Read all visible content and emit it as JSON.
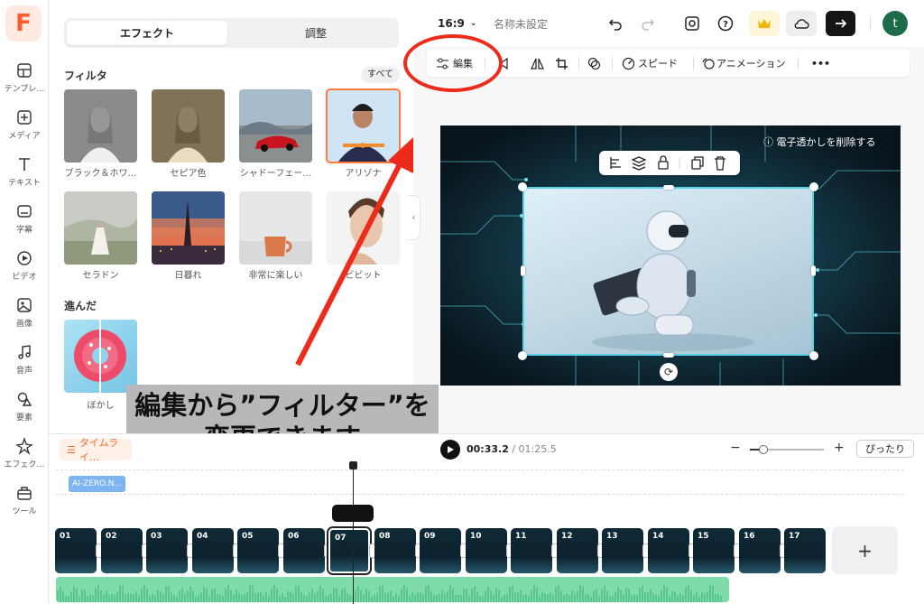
{
  "rail": {
    "items": [
      {
        "label": "テンプレ…",
        "icon": "template-icon"
      },
      {
        "label": "メディア",
        "icon": "media-add-icon"
      },
      {
        "label": "テキスト",
        "icon": "text-icon"
      },
      {
        "label": "字幕",
        "icon": "subtitle-icon"
      },
      {
        "label": "ビデオ",
        "icon": "video-icon"
      },
      {
        "label": "画像",
        "icon": "image-icon"
      },
      {
        "label": "音声",
        "icon": "music-icon"
      },
      {
        "label": "要素",
        "icon": "elements-icon"
      },
      {
        "label": "エフェク…",
        "icon": "effects-icon"
      },
      {
        "label": "ツール",
        "icon": "toolbox-icon"
      }
    ]
  },
  "panel": {
    "tabs": [
      "エフェクト",
      "調整"
    ],
    "filter_title": "フィルタ",
    "see_all": "すべて",
    "filters": [
      {
        "label": "ブラック＆ホワ…"
      },
      {
        "label": "セピア色"
      },
      {
        "label": "シャドーフェー…"
      },
      {
        "label": "アリゾナ"
      },
      {
        "label": "セラドン"
      },
      {
        "label": "日暮れ"
      },
      {
        "label": "非常に楽しい"
      },
      {
        "label": "ビビット"
      }
    ],
    "advanced_title": "進んだ",
    "advanced": [
      {
        "label": "ぼかし"
      }
    ]
  },
  "topbar": {
    "ratio": "16:9",
    "project_name": "名称未設定",
    "avatar_letter": "t"
  },
  "edit_toolbar": {
    "edit": "編集",
    "speed": "スピード",
    "animation": "アニメーション",
    "more": "•••"
  },
  "preview": {
    "watermark": "電子透かしを削除する"
  },
  "annotation": {
    "line1": "編集から”フィルター”を",
    "line2": "変更できます",
    "color": "#ee2a1a"
  },
  "timeline": {
    "button": "タイムライ…",
    "current_time": "00:33.2",
    "total_time": " / 01:25.5",
    "fit": "ぴったり",
    "zoom_level": 0.18,
    "text_clip": "AI-ZERO.N…",
    "clips": [
      "01",
      "02",
      "03",
      "04",
      "05",
      "06",
      "07",
      "08",
      "09",
      "10",
      "11",
      "12",
      "13",
      "14",
      "15",
      "16",
      "17"
    ],
    "selected_clip": "07",
    "add": "+"
  }
}
